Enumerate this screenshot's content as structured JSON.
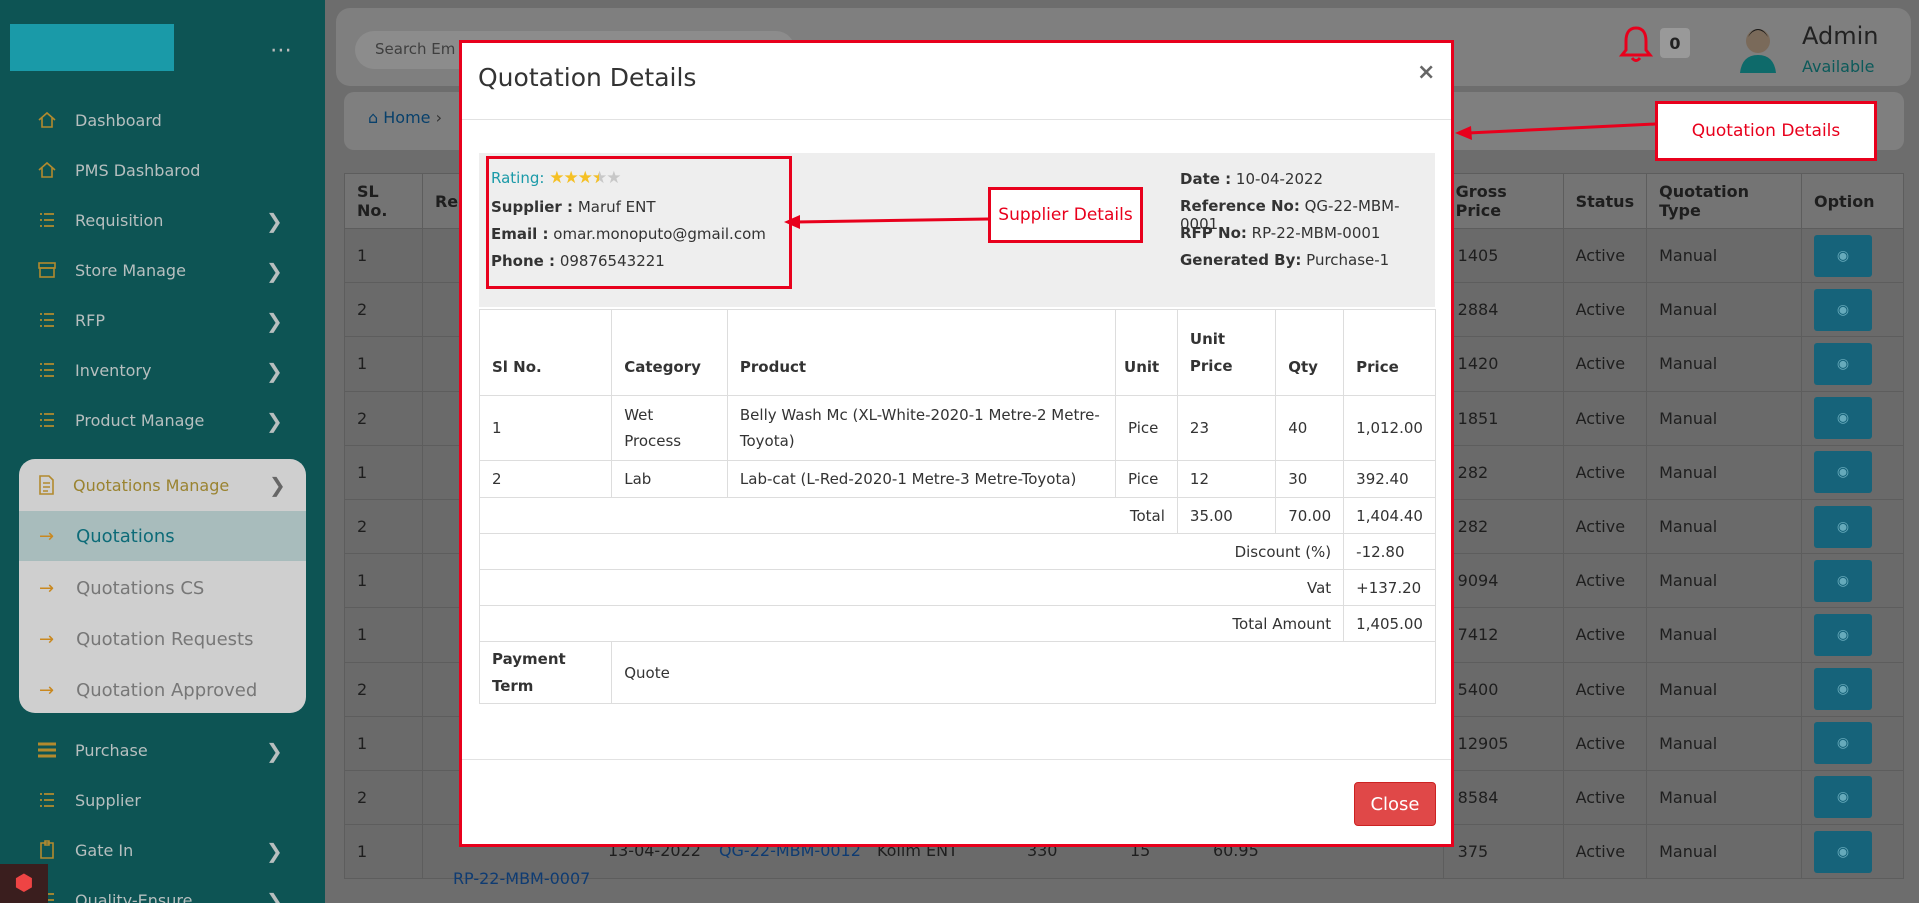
{
  "sidebar": {
    "menu_dots": "⋯",
    "items": [
      {
        "label": "Dashboard",
        "icon": "home-icon",
        "chevron": false
      },
      {
        "label": "PMS Dashbarod",
        "icon": "home-icon",
        "chevron": false
      },
      {
        "label": "Requisition",
        "icon": "list-icon",
        "chevron": true
      },
      {
        "label": "Store Manage",
        "icon": "store-icon",
        "chevron": true
      },
      {
        "label": "RFP",
        "icon": "list-icon",
        "chevron": true
      },
      {
        "label": "Inventory",
        "icon": "list-icon",
        "chevron": true
      },
      {
        "label": "Product Manage",
        "icon": "list-icon",
        "chevron": true
      }
    ],
    "group": {
      "label": "Quotations Manage",
      "sub_items": [
        "Quotations",
        "Quotations CS",
        "Quotation Requests",
        "Quotation Approved"
      ],
      "active_index": 0
    },
    "items_after": [
      {
        "label": "Purchase",
        "icon": "list-icon",
        "chevron": true
      },
      {
        "label": "Supplier",
        "icon": "list-icon",
        "chevron": false
      },
      {
        "label": "Gate In",
        "icon": "gate-icon",
        "chevron": true
      },
      {
        "label": "Quality-Ensure",
        "icon": "list-icon",
        "chevron": true
      }
    ]
  },
  "header": {
    "search_placeholder": "Search Em",
    "notification_count": "0",
    "user_name": "Admin",
    "user_status": "Available"
  },
  "breadcrumb": {
    "home": "Home"
  },
  "background_table": {
    "headers": [
      "SL No.",
      "Re",
      "Gross Price",
      "Status",
      "Quotation Type",
      "Option"
    ],
    "rows": [
      {
        "sl": "1",
        "gross": "1405",
        "status": "Active",
        "type": "Manual"
      },
      {
        "sl": "2",
        "gross": "2884",
        "status": "Active",
        "type": "Manual"
      },
      {
        "sl": "1",
        "gross": "1420",
        "status": "Active",
        "type": "Manual"
      },
      {
        "sl": "2",
        "gross": "1851",
        "status": "Active",
        "type": "Manual"
      },
      {
        "sl": "1",
        "gross": "282",
        "status": "Active",
        "type": "Manual"
      },
      {
        "sl": "2",
        "gross": "282",
        "status": "Active",
        "type": "Manual"
      },
      {
        "sl": "1",
        "gross": "9094",
        "status": "Active",
        "type": "Manual"
      },
      {
        "sl": "1",
        "gross": "7412",
        "status": "Active",
        "type": "Manual"
      },
      {
        "sl": "2",
        "gross": "5400",
        "status": "Active",
        "type": "Manual"
      },
      {
        "sl": "1",
        "gross": "12905",
        "status": "Active",
        "type": "Manual"
      },
      {
        "sl": "2",
        "gross": "8584",
        "status": "Active",
        "type": "Manual"
      },
      {
        "sl": "1",
        "gross": "375",
        "status": "Active",
        "type": "Manual"
      }
    ],
    "last_row_extra": {
      "date": "13-04-2022",
      "quotation": "QG-22-MBM-0012",
      "supplier": "Kolim ENT",
      "c1": "330",
      "c2": "15",
      "c3": "60.95",
      "rfp": "RP-22-MBM-0007"
    }
  },
  "modal": {
    "title": "Quotation Details",
    "close_x": "×",
    "rating_label": "Rating:",
    "rating_value": 3.5,
    "rating_max": 5,
    "supplier_label": "Supplier :",
    "supplier": "Maruf ENT",
    "email_label": "Email :",
    "email": "omar.monoputo@gmail.com",
    "phone_label": "Phone :",
    "phone": "09876543221",
    "date_label": "Date :",
    "date": "10-04-2022",
    "reference_label": "Reference No:",
    "reference": "QG-22-MBM-0001",
    "rfp_label": "RFP No:",
    "rfp": "RP-22-MBM-0001",
    "generated_label": "Generated By:",
    "generated": "Purchase-1",
    "table": {
      "headers": [
        "Sl No.",
        "Category",
        "Product",
        "Unit",
        "Unit Price",
        "Qty",
        "Price"
      ],
      "rows": [
        {
          "sl": "1",
          "category": "Wet Process",
          "product": "Belly Wash Mc (XL-White-2020-1 Metre-2 Metre-Toyota)",
          "unit": "Pice",
          "unit_price": "23",
          "qty": "40",
          "price": "1,012.00"
        },
        {
          "sl": "2",
          "category": "Lab",
          "product": "Lab-cat (L-Red-2020-1 Metre-3 Metre-Toyota)",
          "unit": "Pice",
          "unit_price": "12",
          "qty": "30",
          "price": "392.40"
        }
      ],
      "total_label": "Total",
      "total_unit_price": "35.00",
      "total_qty": "70.00",
      "total_price": "1,404.40",
      "discount_label": "Discount (%)",
      "discount": "-12.80",
      "vat_label": "Vat",
      "vat": "+137.20",
      "total_amount_label": "Total Amount",
      "total_amount": "1,405.00",
      "payment_term_label": "Payment Term",
      "payment_term": "Quote"
    },
    "close_button": "Close"
  },
  "annotations": {
    "supplier_details": "Supplier Details",
    "quotation_details": "Quotation Details"
  },
  "colors": {
    "annotation_red": "#e8001c",
    "accent_teal": "#1a9aa8",
    "close_button": "#e04848"
  }
}
